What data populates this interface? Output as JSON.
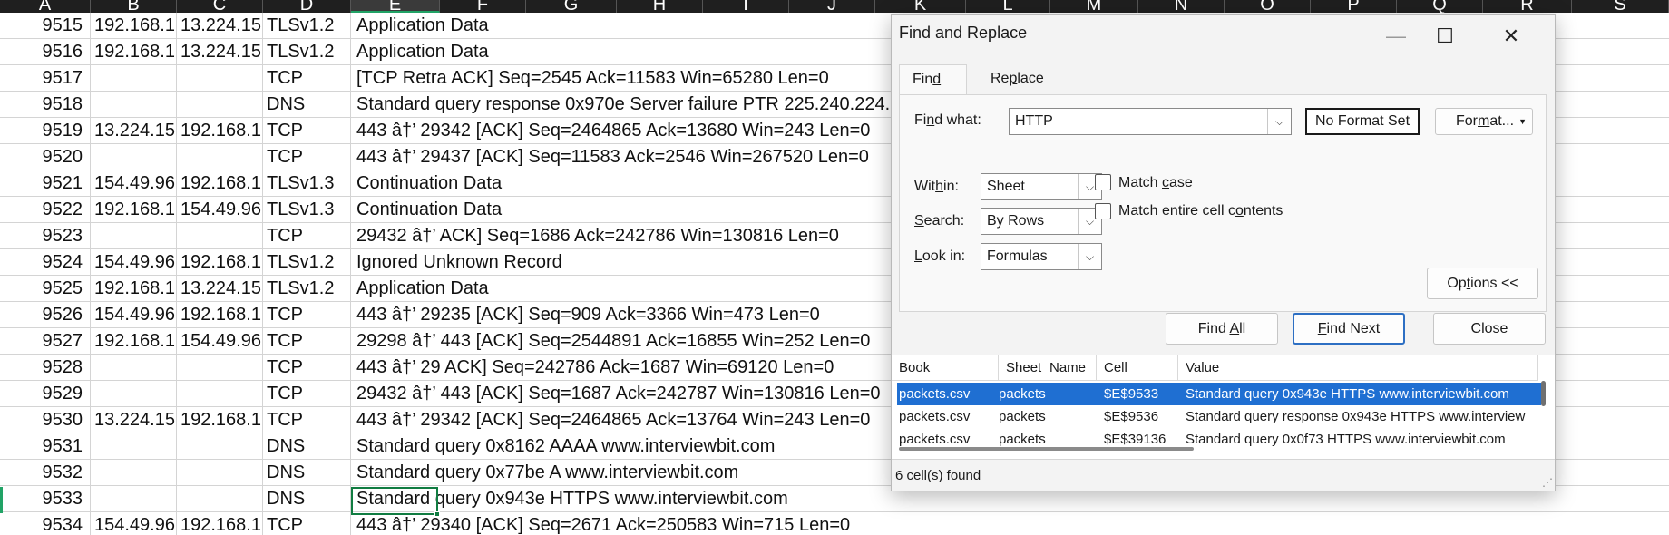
{
  "sheet": {
    "columns": [
      {
        "letter": "A"
      },
      {
        "letter": "B"
      },
      {
        "letter": "C"
      },
      {
        "letter": "D"
      },
      {
        "letter": "E",
        "selected": true
      },
      {
        "letter": "F"
      },
      {
        "letter": "G"
      },
      {
        "letter": "H"
      },
      {
        "letter": "I"
      },
      {
        "letter": "J"
      },
      {
        "letter": "K"
      },
      {
        "letter": "L"
      },
      {
        "letter": "M"
      },
      {
        "letter": "N"
      },
      {
        "letter": "O"
      },
      {
        "letter": "P"
      },
      {
        "letter": "Q"
      },
      {
        "letter": "R"
      },
      {
        "letter": "S"
      }
    ],
    "rows": [
      {
        "no": "9515",
        "src": "192.168.1.",
        "dst": "13.224.15",
        "proto": "TLSv1.2",
        "info": "Application Data"
      },
      {
        "no": "9516",
        "src": "192.168.1.",
        "dst": "13.224.15",
        "proto": "TLSv1.2",
        "info": "Application Data"
      },
      {
        "no": "9517",
        "src": "",
        "dst": "",
        "proto": "TCP",
        "info": "[TCP Retra ACK] Seq=2545 Ack=11583 Win=65280 Len=0"
      },
      {
        "no": "9518",
        "src": "",
        "dst": "",
        "proto": "DNS",
        "info": "Standard query response 0x970e Server failure PTR 225.240.224."
      },
      {
        "no": "9519",
        "src": "13.224.15",
        "dst": "192.168.1.",
        "proto": "TCP",
        "info": "443 â†’ 29342 [ACK] Seq=2464865 Ack=13680 Win=243 Len=0"
      },
      {
        "no": "9520",
        "src": "",
        "dst": "",
        "proto": "TCP",
        "info": "443 â†’ 29437 [ACK] Seq=11583 Ack=2546 Win=267520 Len=0"
      },
      {
        "no": "9521",
        "src": "154.49.96.",
        "dst": "192.168.1.",
        "proto": "TLSv1.3",
        "info": "Continuation Data"
      },
      {
        "no": "9522",
        "src": "192.168.1.",
        "dst": "154.49.96.",
        "proto": "TLSv1.3",
        "info": "Continuation Data"
      },
      {
        "no": "9523",
        "src": "",
        "dst": "",
        "proto": "TCP",
        "info": "29432 â†’  ACK] Seq=1686 Ack=242786 Win=130816 Len=0"
      },
      {
        "no": "9524",
        "src": "154.49.96.",
        "dst": "192.168.1.",
        "proto": "TLSv1.2",
        "info": "Ignored Unknown Record"
      },
      {
        "no": "9525",
        "src": "192.168.1.",
        "dst": "13.224.15",
        "proto": "TLSv1.2",
        "info": "Application Data"
      },
      {
        "no": "9526",
        "src": "154.49.96.",
        "dst": "192.168.1.",
        "proto": "TCP",
        "info": "443 â†’ 29235 [ACK] Seq=909 Ack=3366 Win=473 Len=0"
      },
      {
        "no": "9527",
        "src": "192.168.1.",
        "dst": "154.49.96.",
        "proto": "TCP",
        "info": "29298 â†’ 443 [ACK] Seq=2544891 Ack=16855 Win=252 Len=0"
      },
      {
        "no": "9528",
        "src": "",
        "dst": "",
        "proto": "TCP",
        "info": "443 â†’ 29  ACK] Seq=242786 Ack=1687 Win=69120 Len=0"
      },
      {
        "no": "9529",
        "src": "",
        "dst": "",
        "proto": "TCP",
        "info": "29432 â†’ 443 [ACK] Seq=1687 Ack=242787 Win=130816 Len=0"
      },
      {
        "no": "9530",
        "src": "13.224.15",
        "dst": "192.168.1.",
        "proto": "TCP",
        "info": "443 â†’ 29342 [ACK] Seq=2464865 Ack=13764 Win=243 Len=0"
      },
      {
        "no": "9531",
        "src": "",
        "dst": "",
        "proto": "DNS",
        "info": "Standard query 0x8162 AAAA www.interviewbit.com"
      },
      {
        "no": "9532",
        "src": "",
        "dst": "",
        "proto": "DNS",
        "info": "Standard query 0x77be A www.interviewbit.com"
      },
      {
        "no": "9533",
        "src": "",
        "dst": "",
        "proto": "DNS",
        "info": "Standard query 0x943e HTTPS www.interviewbit.com"
      },
      {
        "no": "9534",
        "src": "154.49.96.",
        "dst": "192.168.1.",
        "proto": "TCP",
        "info": "443 â†’ 29340 [ACK] Seq=2671 Ack=250583 Win=715 Len=0"
      }
    ]
  },
  "dialog": {
    "title": "Find and Replace",
    "minimize_glyph": "—",
    "maximize_glyph": "☐",
    "close_glyph": "✕",
    "tabs": [
      {
        "label_pre": "Fin",
        "label_acc": "d",
        "label_post": "",
        "active": true
      },
      {
        "label_pre": "Re",
        "label_acc": "p",
        "label_post": "lace",
        "active": false
      }
    ],
    "find_what_label_pre": "Fi",
    "find_what_label_acc": "n",
    "find_what_label_post": "d what:",
    "find_what_value": "HTTP",
    "no_format_label": "No Format Set",
    "format_label_pre": "For",
    "format_label_acc": "m",
    "format_label_post": "at...",
    "within_label_pre": "Wit",
    "within_label_acc": "h",
    "within_label_post": "in:",
    "within_value": "Sheet",
    "search_label_pre": "",
    "search_label_acc": "S",
    "search_label_post": "earch:",
    "search_value": "By Rows",
    "lookin_label_pre": "",
    "lookin_label_acc": "L",
    "lookin_label_post": "ook in:",
    "lookin_value": "Formulas",
    "match_case_pre": "Match ",
    "match_case_acc": "c",
    "match_case_post": "ase",
    "match_case_checked": false,
    "match_entire_pre": "Match entire cell c",
    "match_entire_acc": "o",
    "match_entire_post": "ntents",
    "match_entire_checked": false,
    "options_pre": "Op",
    "options_acc": "t",
    "options_post": "ions <<",
    "find_all_pre": "Find ",
    "find_all_acc": "A",
    "find_all_post": "ll",
    "find_next_pre": "",
    "find_next_acc": "F",
    "find_next_post": "ind Next",
    "close_label": "Close",
    "results": {
      "headers": [
        "Book",
        "Sheet",
        "Name",
        "Cell",
        "Value"
      ],
      "rows": [
        {
          "book": "packets.csv",
          "sheet": "packets",
          "name": "",
          "cell": "$E$9533",
          "value": "Standard query 0x943e HTTPS www.interviewbit.com",
          "selected": true
        },
        {
          "book": "packets.csv",
          "sheet": "packets",
          "name": "",
          "cell": "$E$9536",
          "value": "Standard query response 0x943e HTTPS www.interview",
          "selected": false
        },
        {
          "book": "packets.csv",
          "sheet": "packets",
          "name": "",
          "cell": "$E$39136",
          "value": "Standard query 0x0f73 HTTPS www.interviewbit.com",
          "selected": false
        }
      ]
    },
    "status": "6 cell(s) found",
    "grip_glyph": "⋰"
  },
  "colors": {
    "accent": "#1f6fd2",
    "excel_green": "#107c41",
    "header_bg": "#1f1f1f"
  }
}
